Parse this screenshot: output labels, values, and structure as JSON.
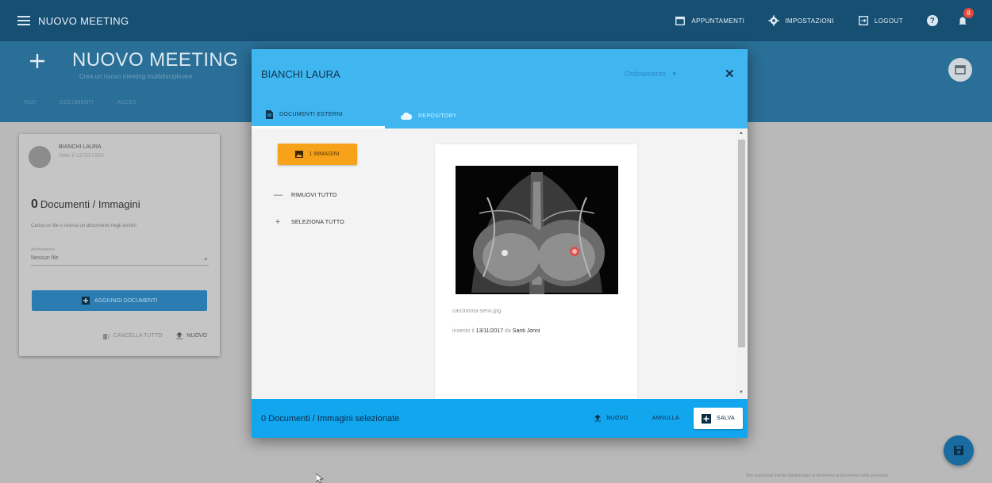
{
  "appbar": {
    "title": "NUOVO MEETING",
    "actions": [
      {
        "label": "APPUNTAMENTI",
        "icon": "calendar-icon"
      },
      {
        "label": "IMPOSTAZIONI",
        "icon": "gear-icon"
      },
      {
        "label": "LOGOUT",
        "icon": "logout-icon"
      }
    ],
    "help_icon": "?",
    "notification_badge": "8"
  },
  "page_header": {
    "title": "NUOVO MEETING",
    "subtitle": "Crea un nuovo meeting multidisciplinare",
    "tabs": [
      "INIZI",
      "DOCUMENTI",
      "ACCES"
    ]
  },
  "patient_card": {
    "name": "BIANCHI LAURA",
    "date": "Nato il 12/10/1956",
    "count_number": "0",
    "count_label": "Documenti / Immagini",
    "hint": "Carica un file o ricerca un documento negli archivi",
    "select_label": "Archiviazione",
    "select_value": "Nessun file",
    "add_button": "AGGIUNGI DOCUMENTI",
    "cancel_all": "CANCELLA TUTTO",
    "new_label": "NUOVO"
  },
  "dialog": {
    "patient_name": "BIANCHI LAURA",
    "sort_label": "Ordinamento",
    "tabs": [
      "DOCUMENTI ESTERNI",
      "REPOSITORY"
    ],
    "images_button": "1 IMMAGINI",
    "remove_all": "RIMUOVI TUTTO",
    "select_all": "SELEZIONA TUTTO",
    "document": {
      "filename": "carcinoma-seno.jpg",
      "inserted_prefix": "inserito il",
      "inserted_date": "13/11/2017",
      "by_prefix": "da",
      "author": "Santi Jonni"
    },
    "footer": {
      "selected_text": "0 Documenti / Immagini selezionate",
      "new_button": "NUOVO",
      "cancel_button": "ANNULLA",
      "save_button": "SALVA"
    }
  },
  "footer_note": "Non selezionati tramite dati/immagini al riferimento al documento nella procedura",
  "colors": {
    "appbar": "#174f73",
    "dialog_header": "#40b6f1",
    "dialog_footer": "#12a6ef",
    "accent_orange": "#f7a21b"
  }
}
